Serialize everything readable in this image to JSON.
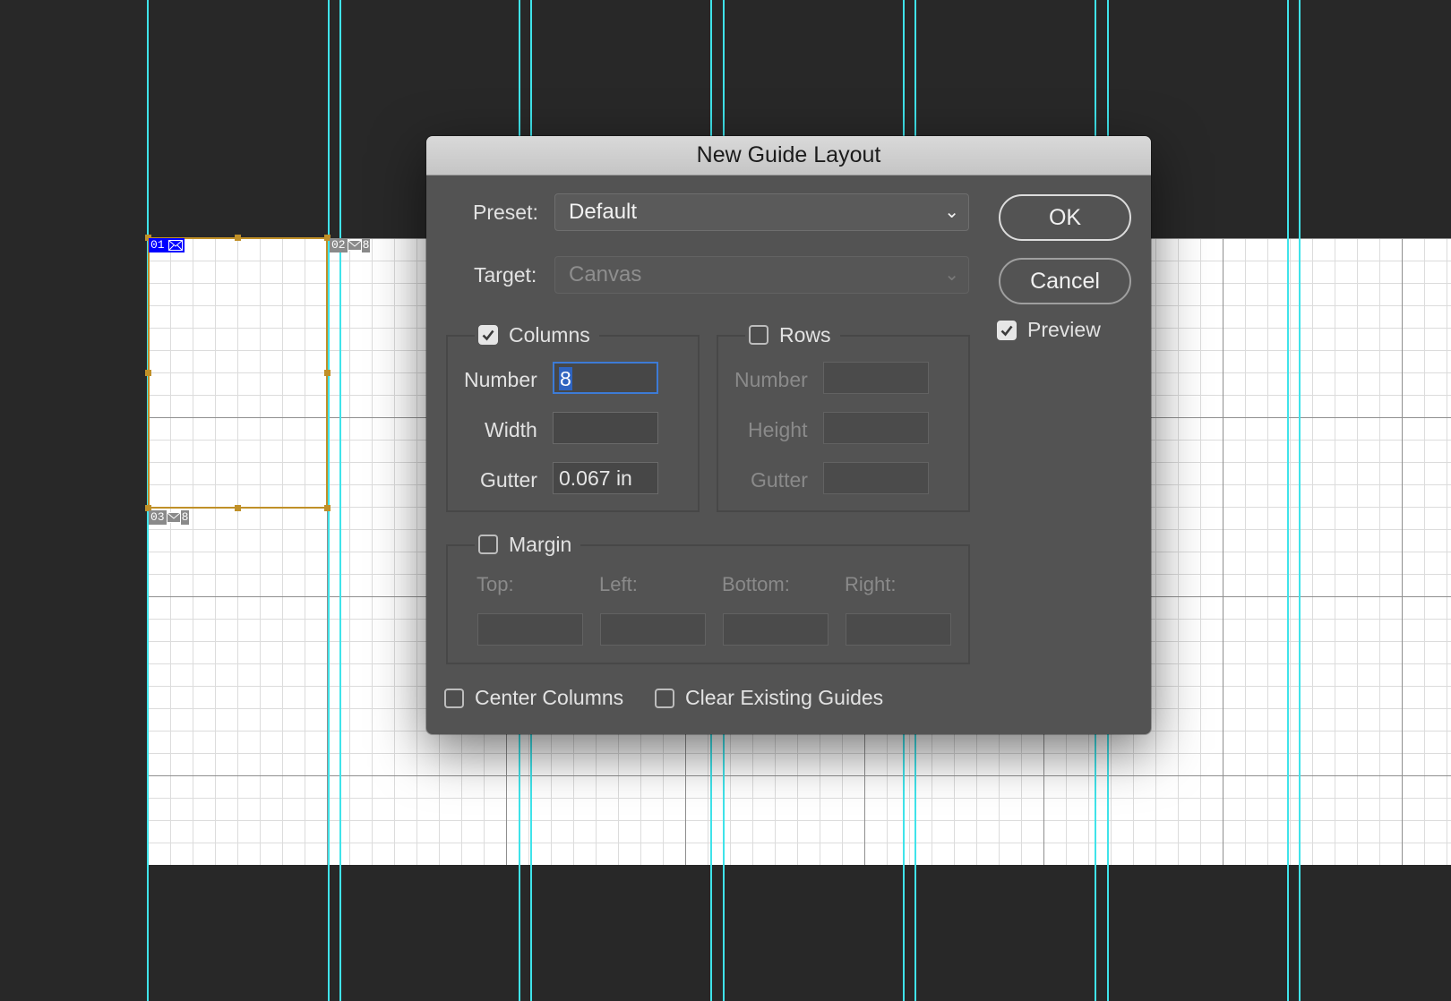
{
  "canvas": {
    "slices": [
      {
        "number": "01",
        "extra": ""
      },
      {
        "number": "02",
        "extra": "8"
      },
      {
        "number": "03",
        "extra": "8"
      }
    ],
    "colors": {
      "guide": "#3fe3ea",
      "slice_border": "#c09028",
      "slice_selected": "#0000ff",
      "workspace": "#282828"
    }
  },
  "dialog": {
    "title": "New Guide Layout",
    "preset": {
      "label": "Preset:",
      "value": "Default"
    },
    "target": {
      "label": "Target:",
      "value": "Canvas"
    },
    "columns": {
      "label": "Columns",
      "checked": true,
      "number_label": "Number",
      "number_value": "8",
      "width_label": "Width",
      "width_value": "",
      "gutter_label": "Gutter",
      "gutter_value": "0.067 in"
    },
    "rows": {
      "label": "Rows",
      "checked": false,
      "number_label": "Number",
      "height_label": "Height",
      "gutter_label": "Gutter"
    },
    "margin": {
      "label": "Margin",
      "checked": false,
      "top_label": "Top:",
      "left_label": "Left:",
      "bottom_label": "Bottom:",
      "right_label": "Right:"
    },
    "center_columns": {
      "label": "Center Columns",
      "checked": false
    },
    "clear_guides": {
      "label": "Clear Existing Guides",
      "checked": false
    },
    "ok_label": "OK",
    "cancel_label": "Cancel",
    "preview": {
      "label": "Preview",
      "checked": true
    }
  }
}
